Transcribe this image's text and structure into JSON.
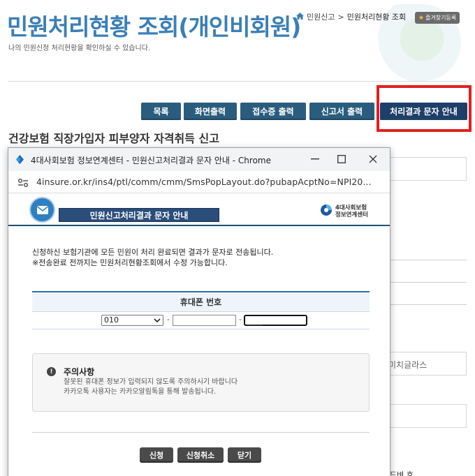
{
  "page": {
    "title": "민원처리현황 조회(개인비회원)",
    "subtitle": "나의 민원신청 처리현황을 확인하실 수 있습니다.",
    "breadcrumb": {
      "home": "민원신고",
      "separator": ">",
      "current": "민원처리현황 조회"
    },
    "favorite_label": "즐겨찾기등록",
    "buttons": {
      "list": "목록",
      "print_screen": "화면출력",
      "receipt_print": "접수증 출력",
      "report_print": "신고서 출력",
      "sms_notice": "처리결과 문자 안내"
    },
    "section_title": "건강보험 직장가입자 피부양자 자격취득 신고",
    "right_text_1": "미치글라스",
    "right_text_2": "드벼 호"
  },
  "popup": {
    "window_title": "4대사회보험 정보연계센터 - 민원신고처리결과 문자 안내 - Chrome",
    "url": "4insure.or.kr/ins4/ptl/comm/cmm/SmsPopLayout.do?pubapAcptNo=NPI20...",
    "header_title": "민원신고처리결과 문자 안내",
    "brand_line1": "4대사회보험",
    "brand_line2": "정보연계센터",
    "message_line1": "신청하신 보험기관에 모든 민원이 처리 완료되면 결과가 문자로 전송됩니다.",
    "message_line2": "※전송완료 전까지는 민원처리현황조회에서 수정 가능합니다.",
    "phone_header": "휴대폰 번호",
    "phone_prefix": "010",
    "phone_dash": "-",
    "phone_last_placeholder": "____",
    "notice_title": "주의사항",
    "notice_line1": "잘못된 휴대폰 정보가 입력되지 않도록 주의하시기 바랍니다",
    "notice_line2": "카카오톡 사용자는 카카오알림톡을 통해 발송됩니다.",
    "btn_apply": "신청",
    "btn_cancel_apply": "신청취소",
    "btn_close": "닫기"
  },
  "colors": {
    "title_blue": "#3b7fb6",
    "button_blue": "#2a5d7d",
    "highlight_red": "#e02020",
    "popup_band": "#2a4d7a"
  },
  "icons": [
    "home-icon",
    "star-icon",
    "chrome-icon",
    "minimize-icon",
    "maximize-icon",
    "close-icon",
    "site-info-icon",
    "mail-logo-icon",
    "brand-logo-icon",
    "chevron-down-icon",
    "alert-icon"
  ]
}
